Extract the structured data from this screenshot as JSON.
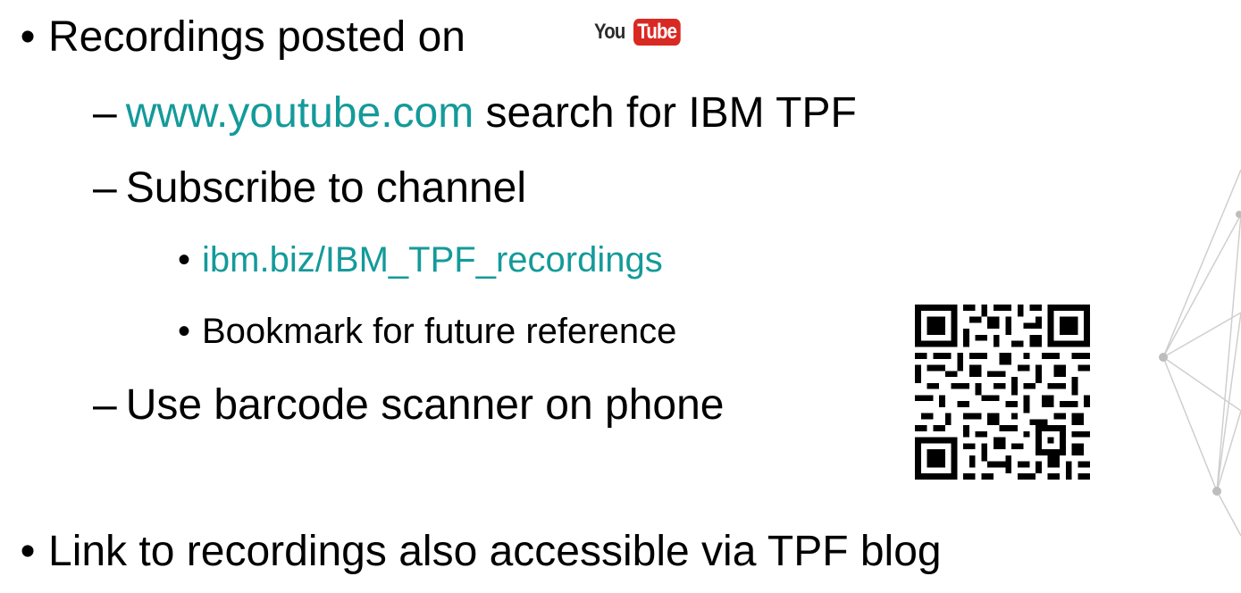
{
  "slide": {
    "bullet1": {
      "bullet": "•",
      "text": "Recordings posted on"
    },
    "logo": {
      "you": "You",
      "tube": "Tube",
      "brand_color": "#d92923"
    },
    "sub1": {
      "dash": "–",
      "link": "www.youtube.com",
      "rest": " search for IBM TPF"
    },
    "sub2": {
      "dash": "–",
      "text": "Subscribe to channel"
    },
    "subsub1": {
      "bullet": "•",
      "link": "ibm.biz/IBM_TPF_recordings"
    },
    "subsub2": {
      "bullet": "•",
      "text": "Bookmark for future reference"
    },
    "sub3": {
      "dash": "–",
      "text": "Use barcode scanner on phone"
    },
    "bullet2": {
      "bullet": "•",
      "text": "Link to recordings also accessible via TPF blog"
    }
  },
  "colors": {
    "link": "#149a9a",
    "text": "#000000"
  },
  "icons": {
    "qr": "qr-code-icon",
    "decoration": "network-graph-icon"
  }
}
